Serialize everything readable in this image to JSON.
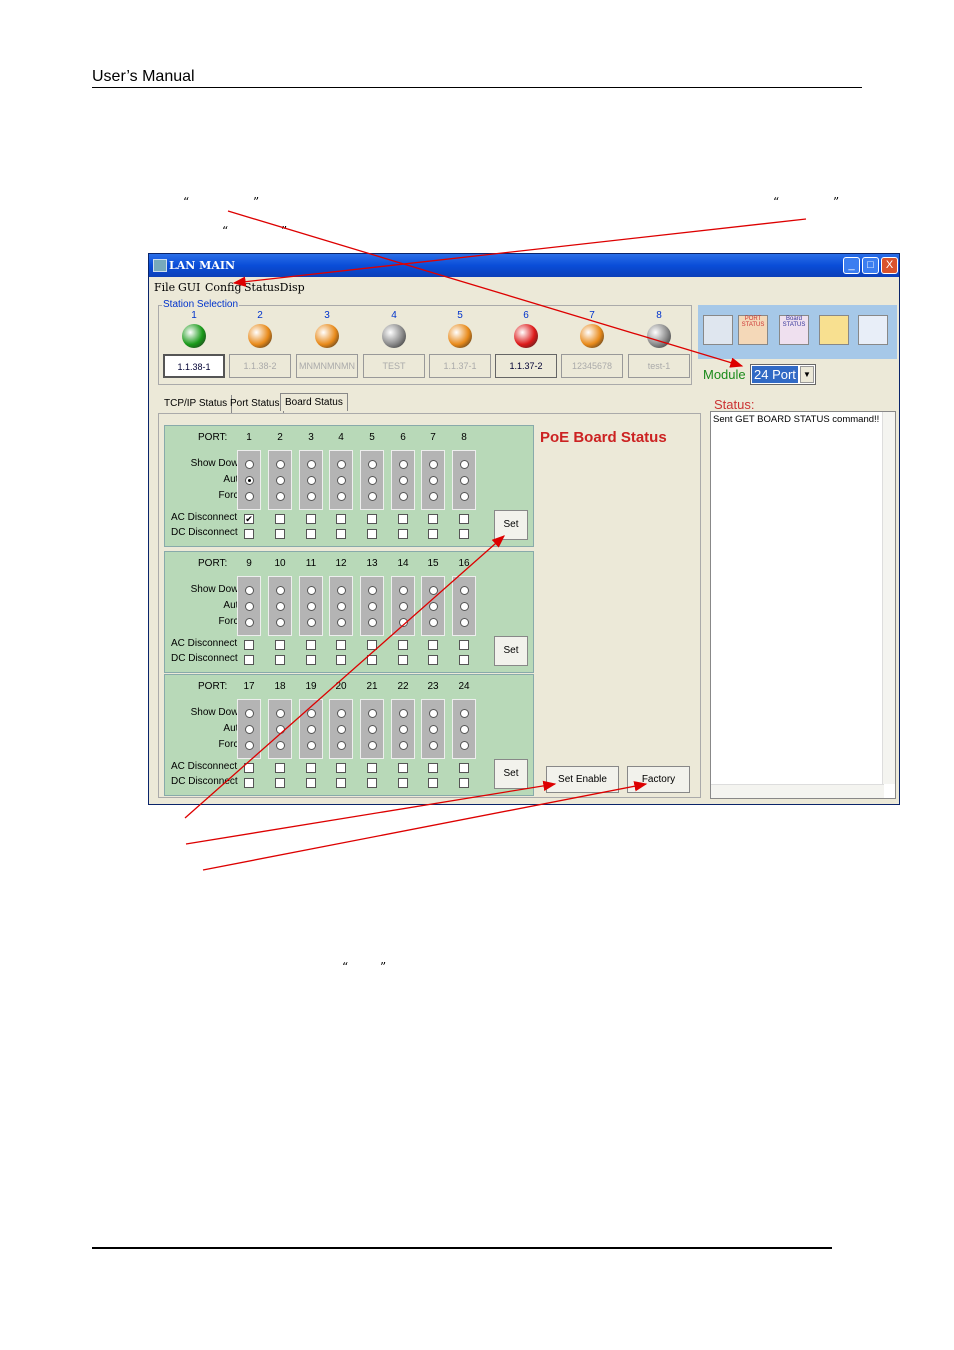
{
  "header": {
    "title": "User’s  Manual"
  },
  "quotes": {
    "open": "“",
    "close": "”"
  },
  "window": {
    "title": "LAN MAIN",
    "buttons": [
      "_",
      "□",
      "X"
    ],
    "menu": [
      "File",
      "GUI",
      "Config",
      "StatusDisp"
    ]
  },
  "stations": {
    "legend": "Station Selection",
    "items": [
      {
        "num": "1",
        "led": "#1a9a1a",
        "label": "1.1.38-1"
      },
      {
        "num": "2",
        "led": "#e88a1a",
        "label": "1.1.38-2"
      },
      {
        "num": "3",
        "led": "#e88a1a",
        "label": "MNMNMNMN"
      },
      {
        "num": "4",
        "led": "#8a8a8a",
        "label": "TEST"
      },
      {
        "num": "5",
        "led": "#e88a1a",
        "label": "1.1.37-1"
      },
      {
        "num": "6",
        "led": "#dd1a1a",
        "label": "1.1.37-2"
      },
      {
        "num": "7",
        "led": "#e88a1a",
        "label": "12345678"
      },
      {
        "num": "8",
        "led": "#8a8a8a",
        "label": "test-1"
      }
    ]
  },
  "toolbar": {
    "port_status": "PORT STATUS",
    "board_status": "Board STATUS"
  },
  "module": {
    "label": "Module",
    "value": "24 Port"
  },
  "tabs": [
    "TCP/IP Status",
    "Port Status",
    "Board Status"
  ],
  "board": {
    "title": "PoE Board Status",
    "port_label": "PORT:",
    "rows": [
      "Show Down",
      "Auto",
      "Force"
    ],
    "ac": "AC Disconnect",
    "dc": "DC Disconnect",
    "set": "Set",
    "groups": [
      {
        "ports": [
          "1",
          "2",
          "3",
          "4",
          "5",
          "6",
          "7",
          "8"
        ]
      },
      {
        "ports": [
          "9",
          "10",
          "11",
          "12",
          "13",
          "14",
          "15",
          "16"
        ]
      },
      {
        "ports": [
          "17",
          "18",
          "19",
          "20",
          "21",
          "22",
          "23",
          "24"
        ]
      }
    ],
    "set_enable": "Set Enable",
    "factory": "Factory"
  },
  "status": {
    "label": "Status:",
    "text": "Sent GET BOARD STATUS command!!"
  },
  "colors": {
    "panel": "#b8d9b8",
    "arrow": "#dd0000",
    "title_red": "#cc2222"
  }
}
